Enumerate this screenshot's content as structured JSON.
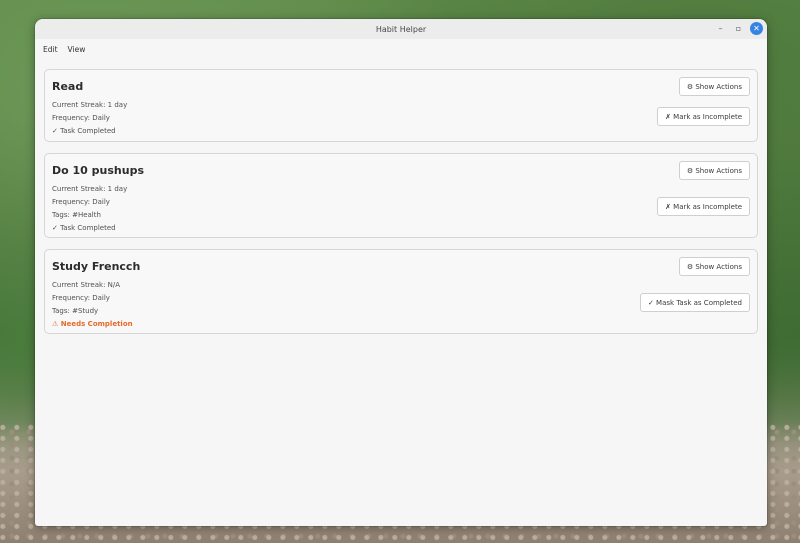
{
  "window": {
    "title": "Habit Helper"
  },
  "menu": {
    "edit": "Edit",
    "view": "View"
  },
  "habits": [
    {
      "name": "Read",
      "streak": "Current Streak: 1 day",
      "frequency": "Frequency: Daily",
      "tags": "",
      "status": "✓ Task Completed",
      "status_kind": "completed",
      "actions_label": "⚙ Show Actions",
      "toggle_label": "✗ Mark as Incomplete"
    },
    {
      "name": "Do 10 pushups",
      "streak": "Current Streak: 1 day",
      "frequency": "Frequency: Daily",
      "tags": "Tags:  #Health",
      "status": "✓ Task Completed",
      "status_kind": "completed",
      "actions_label": "⚙ Show Actions",
      "toggle_label": "✗ Mark as Incomplete"
    },
    {
      "name": "Study Frencch",
      "streak": "Current Streak: N/A",
      "frequency": "Frequency: Daily",
      "tags": "Tags:  #Study",
      "status": "⚠ Needs Completion",
      "status_kind": "pending",
      "actions_label": "⚙ Show Actions",
      "toggle_label": "✓ Mask Task as Completed"
    }
  ],
  "colors": {
    "accent": "#3584e4",
    "warning": "#e66a2c"
  }
}
